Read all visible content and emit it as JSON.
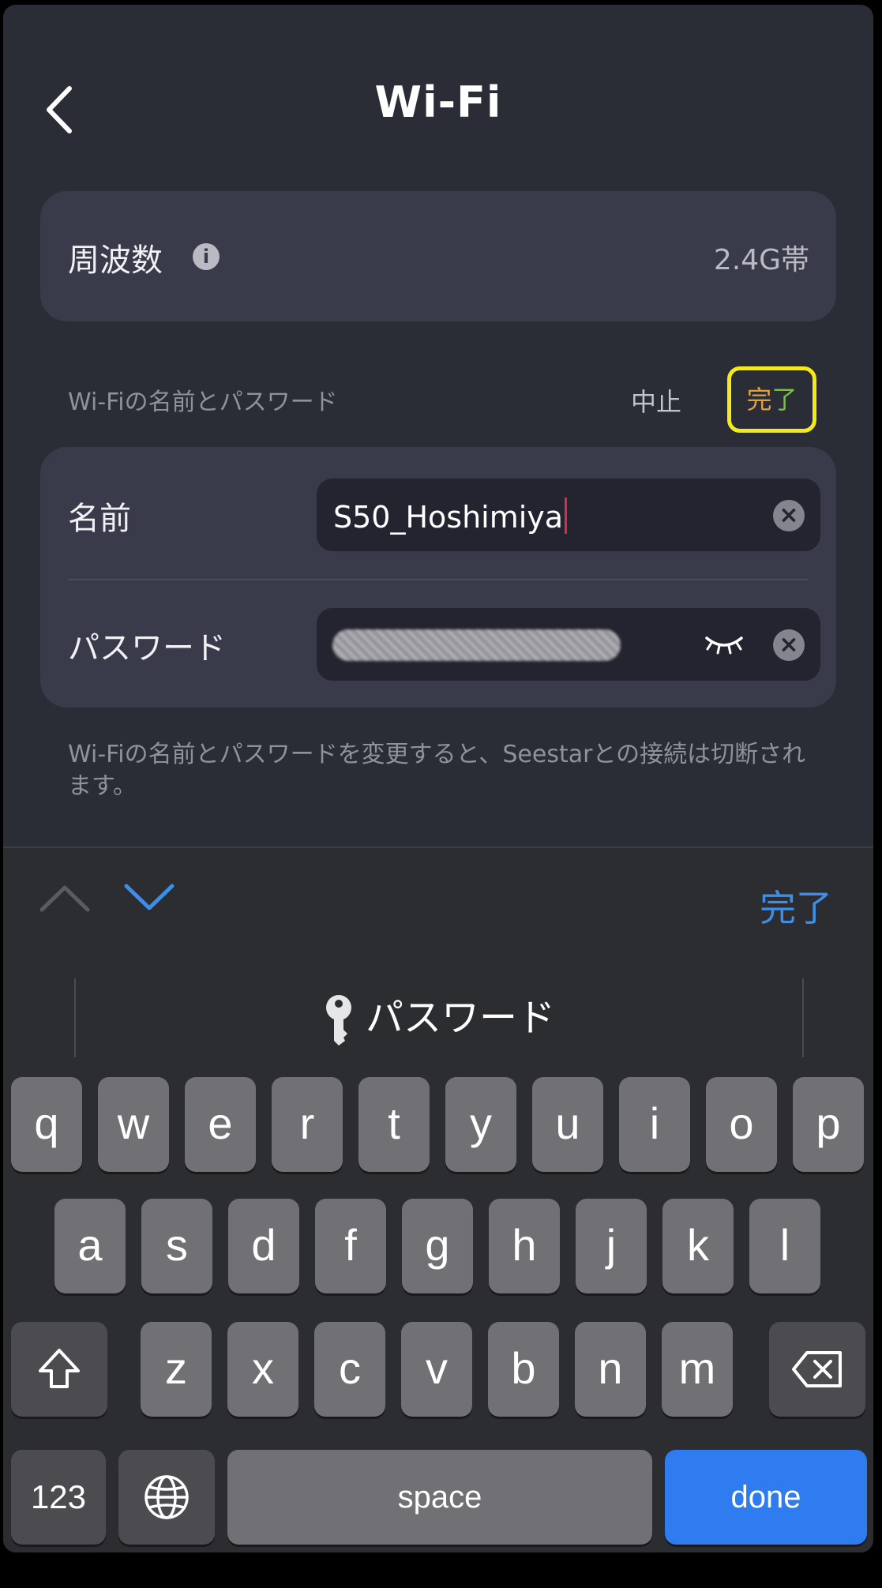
{
  "header": {
    "title": "Wi-Fi",
    "back_icon": "chevron-left-icon"
  },
  "frequency": {
    "label": "周波数",
    "info_icon": "i",
    "value": "2.4G帯"
  },
  "wifi_section": {
    "label": "Wi-Fiの名前とパスワード",
    "cancel_label": "中止",
    "done_part1": "完",
    "done_part2": "了"
  },
  "form": {
    "name_label": "名前",
    "name_value": "S50_Hoshimiya",
    "password_label": "パスワード",
    "clear_icon": "×"
  },
  "hint": "Wi-Fiの名前とパスワードを変更すると、Seestarとの接続は切断されます。",
  "keyboard": {
    "accessory_done": "完了",
    "password_suggestion": "パスワード",
    "row1": [
      "q",
      "w",
      "e",
      "r",
      "t",
      "y",
      "u",
      "i",
      "o",
      "p"
    ],
    "row2": [
      "a",
      "s",
      "d",
      "f",
      "g",
      "h",
      "j",
      "k",
      "l"
    ],
    "row3": [
      "z",
      "x",
      "c",
      "v",
      "b",
      "n",
      "m"
    ],
    "numbers_key": "123",
    "space_key": "space",
    "done_key": "done"
  },
  "colors": {
    "done_highlight_border": "#f2ea1b",
    "keyboard_done": "#2f7bf0",
    "accessory_done": "#3d8ee8"
  }
}
